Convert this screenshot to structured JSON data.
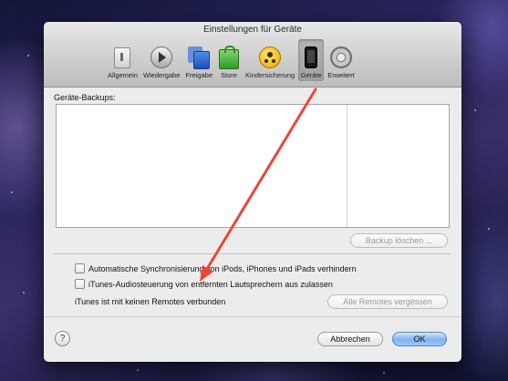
{
  "window": {
    "title": "Einstellungen für Geräte"
  },
  "toolbar": {
    "items": [
      {
        "label": "Allgemein",
        "icon": "general-icon"
      },
      {
        "label": "Wiedergabe",
        "icon": "playback-icon"
      },
      {
        "label": "Freigabe",
        "icon": "sharing-icon"
      },
      {
        "label": "Store",
        "icon": "store-icon"
      },
      {
        "label": "Kindersicherung",
        "icon": "parental-icon"
      },
      {
        "label": "Geräte",
        "icon": "device-icon",
        "selected": true
      },
      {
        "label": "Erweitert",
        "icon": "gear-icon"
      }
    ]
  },
  "backups": {
    "label": "Geräte-Backups:",
    "delete_button": "Backup löschen ..."
  },
  "options": {
    "auto_sync": {
      "label": "Automatische Synchronisierung von iPods, iPhones und iPads verhindern",
      "checked": false
    },
    "audio_control": {
      "label": "iTunes-Audiosteuerung von entfernten Lautsprechern aus zulassen",
      "checked": false
    }
  },
  "remotes": {
    "status": "iTunes ist mit keinen Remotes verbunden",
    "forget_button": "Alle Remotes vergessen"
  },
  "footer": {
    "help": "?",
    "cancel": "Abbrechen",
    "ok": "OK"
  },
  "colors": {
    "arrow": "#e8473a",
    "primary_button": "#7fb3ee"
  }
}
